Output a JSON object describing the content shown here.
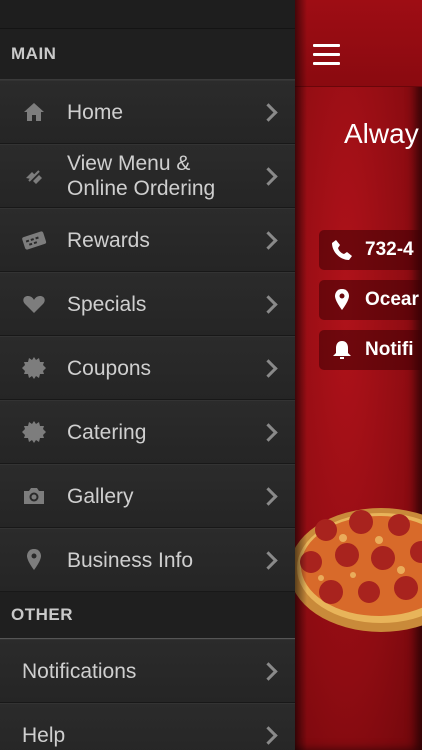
{
  "drawer": {
    "main_header": "MAIN",
    "items": [
      {
        "label": "Home",
        "icon": "home-icon"
      },
      {
        "label": "View Menu & Online Ordering",
        "icon": "menu-link-icon"
      },
      {
        "label": "Rewards",
        "icon": "rewards-card-icon"
      },
      {
        "label": "Specials",
        "icon": "heart-icon"
      },
      {
        "label": "Coupons",
        "icon": "badge-icon"
      },
      {
        "label": "Catering",
        "icon": "badge-icon"
      },
      {
        "label": "Gallery",
        "icon": "camera-icon"
      },
      {
        "label": "Business Info",
        "icon": "location-pin-icon"
      }
    ],
    "other_header": "OTHER",
    "other_items": [
      {
        "label": "Notifications"
      },
      {
        "label": "Help"
      }
    ]
  },
  "main": {
    "tagline": "Alway",
    "phone": "732-4",
    "location": "Ocear",
    "notifications": "Notifi"
  },
  "colors": {
    "brand_red": "#9e0d14",
    "drawer_bg": "#252525"
  }
}
